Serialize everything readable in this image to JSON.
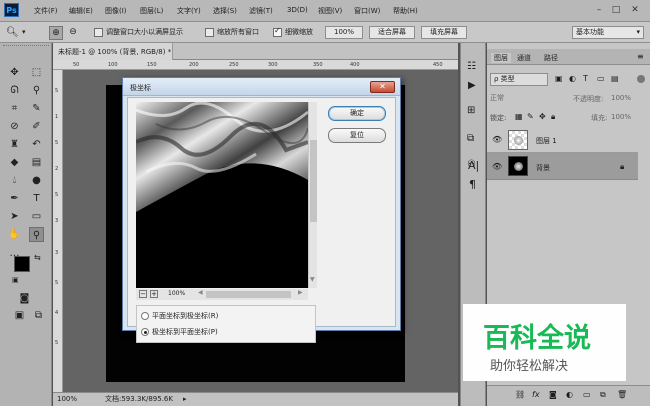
{
  "app": {
    "logo": "Ps"
  },
  "menu": {
    "items": [
      "文件(F)",
      "编辑(E)",
      "图像(I)",
      "图层(L)",
      "文字(Y)",
      "选择(S)",
      "滤镜(T)",
      "3D(D)",
      "视图(V)",
      "窗口(W)",
      "帮助(H)"
    ]
  },
  "window": {
    "minimize": "–",
    "maximize": "□",
    "close": "✕"
  },
  "options": {
    "resize_label": "调整窗口大小以满屏显示",
    "zoom_all_label": "缩放所有窗口",
    "scrubby_label": "细微缩放",
    "zoom_value": "100%",
    "fit_screen": "适合屏幕",
    "fill_screen": "填充屏幕",
    "workspace": "基本功能",
    "resize_checked": false,
    "zoom_all_checked": false,
    "scrubby_checked": true
  },
  "document": {
    "tab_title": "未标题-1 @ 100% (背景, RGB/8) *",
    "status_zoom": "100%",
    "status_doc": "文档:593.3K/895.6K"
  },
  "ruler": {
    "top": [
      "50",
      "100",
      "150",
      "200",
      "250",
      "300",
      "350",
      "400",
      "450"
    ],
    "left": [
      "5",
      "1",
      "5",
      "2",
      "5",
      "3",
      "3",
      "5",
      "4",
      "5"
    ]
  },
  "dialog": {
    "title": "极坐标",
    "ok": "确定",
    "reset": "复位",
    "preview_zoom": "100%",
    "minus": "−",
    "plus": "+",
    "options": [
      {
        "label": "平面坐标到极坐标(R)",
        "selected": false
      },
      {
        "label": "极坐标到平面坐标(P)",
        "selected": true
      }
    ],
    "close": "✕"
  },
  "panel": {
    "tabs": [
      "图层",
      "通道",
      "路径"
    ],
    "kind_filter": "ρ 类型",
    "blend_mode": "正常",
    "opacity_label": "不透明度:",
    "opacity_value": "100%",
    "lock_label": "锁定:",
    "fill_label": "填充:",
    "fill_value": "100%",
    "layers": [
      {
        "name": "图层 1",
        "visible": true,
        "selected": false
      },
      {
        "name": "背景",
        "visible": true,
        "selected": true,
        "locked": true
      }
    ],
    "footer_icons": [
      "link-icon",
      "fx-icon",
      "mask-icon",
      "adjustment-icon",
      "folder-icon",
      "new-layer-icon",
      "trash-icon"
    ]
  },
  "watermark": {
    "title": "百科全说",
    "subtitle": "助你轻松解决",
    "accent": "#19b955"
  }
}
